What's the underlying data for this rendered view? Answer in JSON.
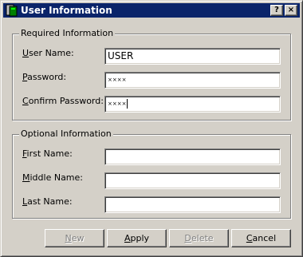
{
  "window": {
    "title": "User Information",
    "help_button": "?",
    "close_button": "×"
  },
  "required": {
    "legend": "Required Information",
    "user_name": {
      "label_key": "U",
      "label_rest": "ser Name:",
      "value": "USER"
    },
    "password": {
      "label_key": "P",
      "label_rest": "assword:",
      "value": "××××"
    },
    "confirm_password": {
      "label_key": "C",
      "label_rest": "onfirm Password:",
      "value": "××××"
    }
  },
  "optional": {
    "legend": "Optional Information",
    "first_name": {
      "label_key": "F",
      "label_rest": "irst Name:",
      "value": ""
    },
    "middle_name": {
      "label_key": "M",
      "label_rest": "iddle Name:",
      "value": ""
    },
    "last_name": {
      "label_key": "L",
      "label_rest": "ast Name:",
      "value": ""
    }
  },
  "buttons": {
    "new": {
      "key": "N",
      "rest": "ew",
      "enabled": false
    },
    "apply": {
      "key": "A",
      "rest": "pply",
      "enabled": true
    },
    "delete": {
      "key": "D",
      "rest": "elete",
      "enabled": false
    },
    "cancel": {
      "key": "C",
      "rest": "ancel",
      "enabled": true
    }
  },
  "colors": {
    "titlebar": "#0a246a",
    "face": "#d4d0c8"
  },
  "icons": {
    "app": "user-info-app-icon",
    "help": "help-icon",
    "close": "close-icon"
  }
}
